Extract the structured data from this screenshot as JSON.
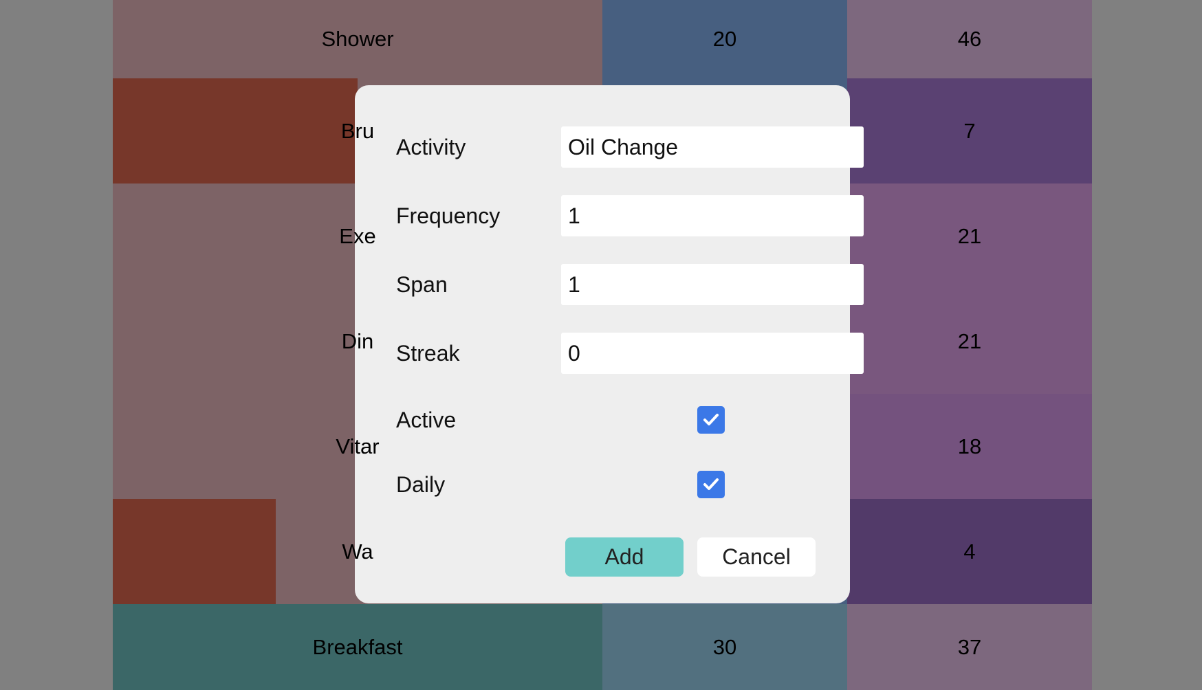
{
  "table": {
    "rows": [
      {
        "name": "Shower",
        "num1": "20",
        "num2": "46",
        "bg_name": "#7d6366",
        "bg_num1": "#475f80",
        "bg_num2": "#7d687e",
        "progress": 0
      },
      {
        "name": "Bru",
        "num1": "",
        "num2": "7",
        "bg_name": "#7d6366",
        "bg_num1": "#475f80",
        "bg_num2": "#5a4172",
        "progress": 0.5
      },
      {
        "name": "Exe",
        "num1": "",
        "num2": "21",
        "bg_name": "#7d6366",
        "bg_num1": "#475f80",
        "bg_num2": "#79577e",
        "progress": 0
      },
      {
        "name": "Din",
        "num1": "",
        "num2": "21",
        "bg_name": "#7d6366",
        "bg_num1": "#475f80",
        "bg_num2": "#79577e",
        "progress": 0
      },
      {
        "name": "Vitar",
        "num1": "",
        "num2": "18",
        "bg_name": "#7d6366",
        "bg_num1": "#475f80",
        "bg_num2": "#74527e",
        "progress": 0
      },
      {
        "name": "Wa",
        "num1": "",
        "num2": "4",
        "bg_name": "#7d6366",
        "bg_num1": "#475f80",
        "bg_num2": "#523a69",
        "progress": 0.333
      },
      {
        "name": "Breakfast",
        "num1": "30",
        "num2": "37",
        "bg_name": "#3b6767",
        "bg_num1": "#52707f",
        "bg_num2": "#7d687e",
        "progress": 0
      }
    ]
  },
  "modal": {
    "fields": [
      {
        "label": "Activity",
        "value": "Oil Change"
      },
      {
        "label": "Frequency",
        "value": "1"
      },
      {
        "label": "Span",
        "value": "1"
      },
      {
        "label": "Streak",
        "value": "0"
      }
    ],
    "checkboxes": [
      {
        "label": "Active",
        "checked": true
      },
      {
        "label": "Daily",
        "checked": true
      }
    ],
    "add_label": "Add",
    "cancel_label": "Cancel"
  },
  "colors": {
    "add_button": "#72cfcb",
    "checkbox": "#3b78e7"
  }
}
